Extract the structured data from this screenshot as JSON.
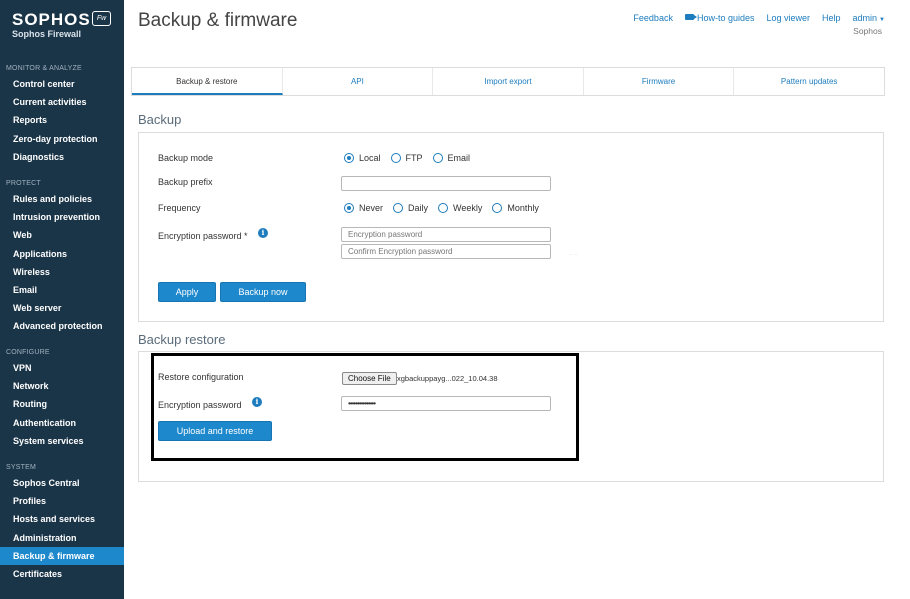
{
  "brand": {
    "name": "SOPHOS",
    "badge": "Fw",
    "product": "Sophos Firewall"
  },
  "sidebar": {
    "sections": [
      {
        "heading": "MONITOR & ANALYZE",
        "items": [
          "Control center",
          "Current activities",
          "Reports",
          "Zero-day protection",
          "Diagnostics"
        ]
      },
      {
        "heading": "PROTECT",
        "items": [
          "Rules and policies",
          "Intrusion prevention",
          "Web",
          "Applications",
          "Wireless",
          "Email",
          "Web server",
          "Advanced protection"
        ]
      },
      {
        "heading": "CONFIGURE",
        "items": [
          "VPN",
          "Network",
          "Routing",
          "Authentication",
          "System services"
        ]
      },
      {
        "heading": "SYSTEM",
        "items": [
          "Sophos Central",
          "Profiles",
          "Hosts and services",
          "Administration",
          "Backup & firmware",
          "Certificates"
        ]
      }
    ],
    "active_item": "Backup & firmware"
  },
  "header": {
    "title": "Backup & firmware",
    "links": {
      "feedback": "Feedback",
      "guides": "How-to guides",
      "log_viewer": "Log viewer",
      "help": "Help",
      "user": "admin"
    },
    "company": "Sophos"
  },
  "tabs": [
    "Backup & restore",
    "API",
    "Import export",
    "Firmware",
    "Pattern updates"
  ],
  "backup": {
    "section_title": "Backup",
    "mode_label": "Backup mode",
    "mode_options": [
      "Local",
      "FTP",
      "Email"
    ],
    "mode_selected": "Local",
    "prefix_label": "Backup prefix",
    "prefix_value": "",
    "frequency_label": "Frequency",
    "frequency_options": [
      "Never",
      "Daily",
      "Weekly",
      "Monthly"
    ],
    "frequency_selected": "Never",
    "encryption_label": "Encryption password *",
    "encryption_placeholder": "Encryption password",
    "confirm_placeholder": "Confirm Encryption password",
    "apply_label": "Apply",
    "backup_now_label": "Backup now"
  },
  "restore": {
    "section_title": "Backup restore",
    "config_label": "Restore configuration",
    "choose_file_label": "Choose File",
    "file_name": "xgbackuppayg...022_10.04.38",
    "encryption_label": "Encryption password",
    "encryption_value": "•••••••••••••••",
    "upload_label": "Upload and restore"
  },
  "colors": {
    "sidebar_bg": "#1b3548",
    "accent": "#1e88cc",
    "link": "#1d7cbd"
  },
  "icons": {
    "info": "info-icon",
    "video": "video-camera-icon",
    "caret": "caret-down-icon"
  }
}
